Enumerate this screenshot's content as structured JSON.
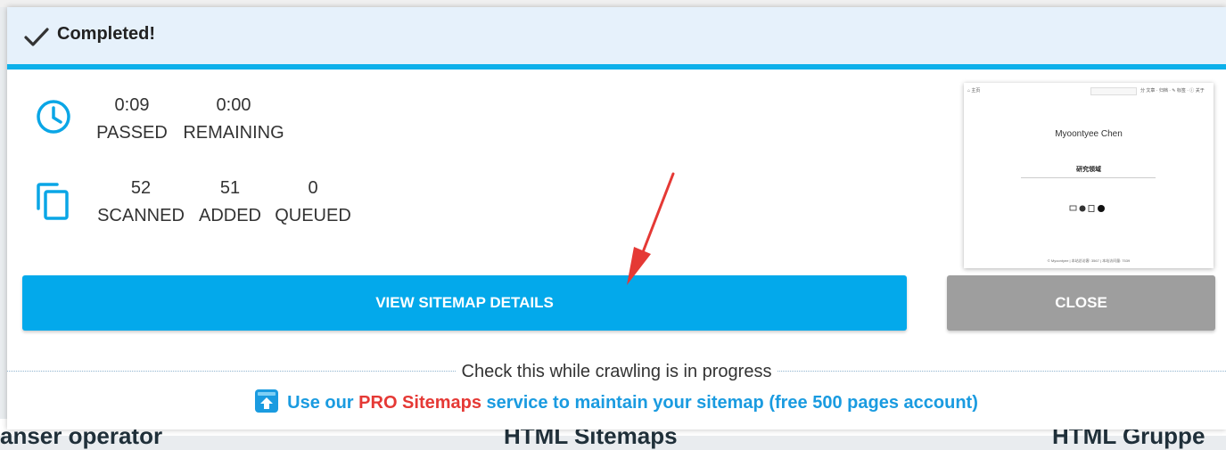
{
  "header": {
    "title": "Completed!",
    "icon": "checkmark-icon"
  },
  "time_stats": [
    {
      "value": "0:09",
      "label": "PASSED"
    },
    {
      "value": "0:00",
      "label": "REMAINING"
    }
  ],
  "page_stats": [
    {
      "value": "52",
      "label": "SCANNED"
    },
    {
      "value": "51",
      "label": "ADDED"
    },
    {
      "value": "0",
      "label": "QUEUED"
    }
  ],
  "buttons": {
    "view_details": "VIEW SITEMAP DETAILS",
    "close": "CLOSE"
  },
  "preview": {
    "nav_home": "⌂ 主页",
    "menu": "分 文章 · 归档 · ✎ 标签 · ⓘ 关于",
    "name": "Myoontyee Chen",
    "section": "研究领域",
    "footer": "© Myoontyee | 本站总访客: 3567 | 本站访问量: 7539"
  },
  "footer": {
    "check_text": "Check this while crawling is in progress",
    "promo_prefix": "Use our ",
    "promo_highlight": "PRO Sitemaps",
    "promo_suffix": " service to maintain your sitemap (free 500 pages account)"
  },
  "background_text": [
    "anser operator",
    "HTML Sitemaps",
    "HTML Gruppe"
  ],
  "colors": {
    "accent": "#03a9eb",
    "close": "#9e9e9e",
    "header_bg": "#e6f1fb",
    "pro": "#e53935",
    "arrow": "#e53935"
  }
}
